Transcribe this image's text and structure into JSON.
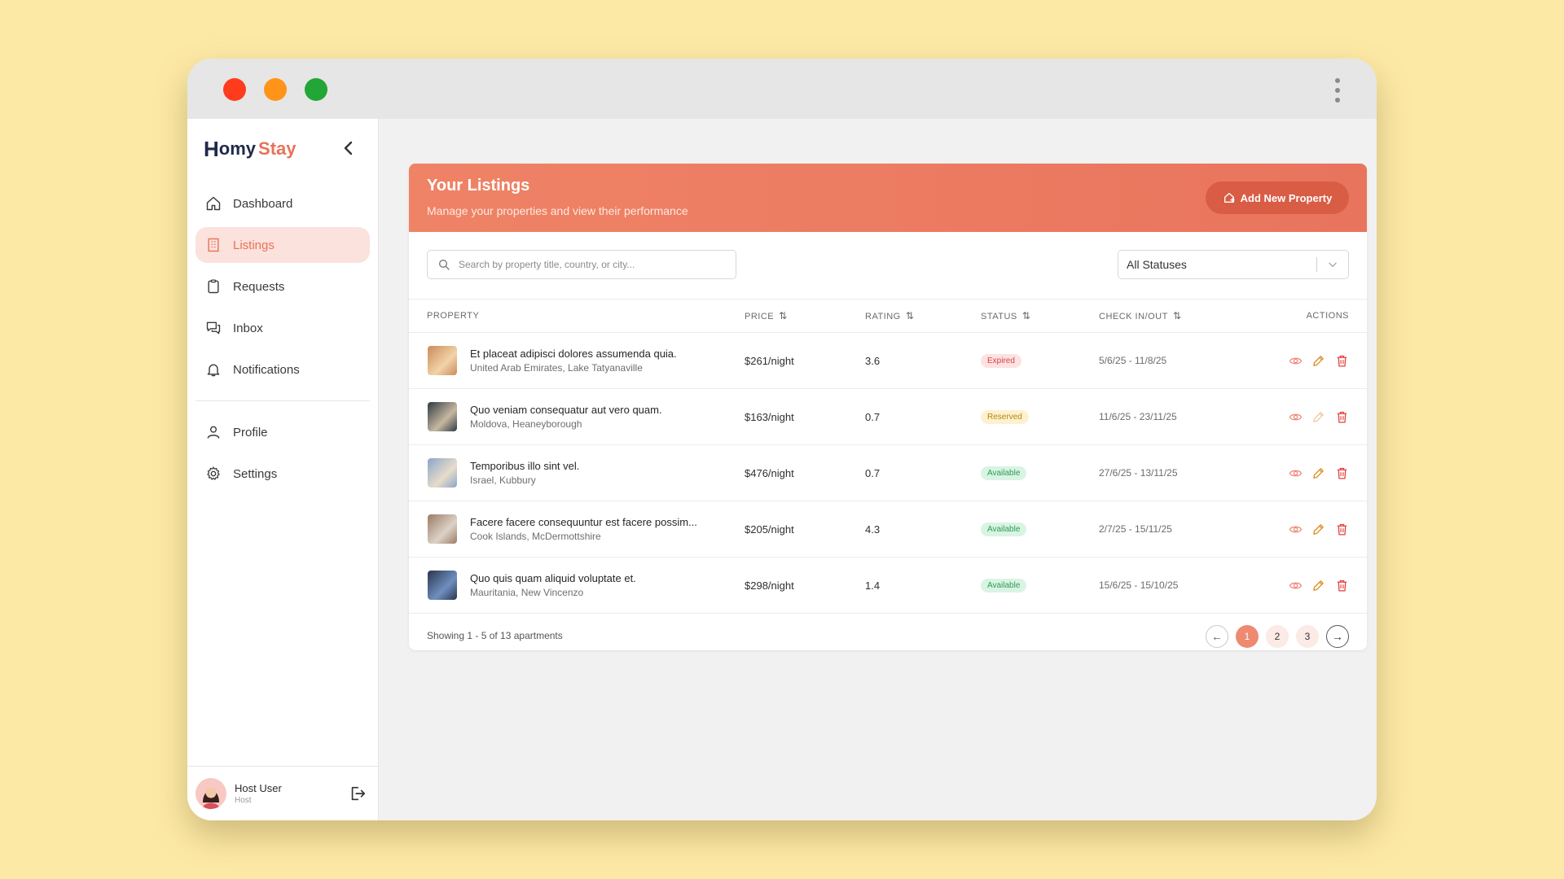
{
  "app": {
    "logo_homy": "omy",
    "logo_h": "H",
    "logo_stay": "Stay"
  },
  "sidebar": {
    "items": [
      {
        "label": "Dashboard",
        "icon": "home-icon",
        "active": false
      },
      {
        "label": "Listings",
        "icon": "building-icon",
        "active": true
      },
      {
        "label": "Requests",
        "icon": "clipboard-icon",
        "active": false
      },
      {
        "label": "Inbox",
        "icon": "chat-icon",
        "active": false
      },
      {
        "label": "Notifications",
        "icon": "bell-icon",
        "active": false
      }
    ],
    "secondary": [
      {
        "label": "Profile",
        "icon": "user-icon"
      },
      {
        "label": "Settings",
        "icon": "gear-icon"
      }
    ],
    "user": {
      "name": "Host User",
      "role": "Host"
    }
  },
  "header": {
    "title": "Your Listings",
    "subtitle": "Manage your properties and view their performance",
    "add_label": "Add New Property"
  },
  "filters": {
    "search_placeholder": "Search by property title, country, or city...",
    "status_value": "All Statuses"
  },
  "table": {
    "columns": [
      "PROPERTY",
      "PRICE",
      "RATING",
      "STATUS",
      "CHECK IN/OUT",
      "ACTIONS"
    ],
    "rows": [
      {
        "title": "Et placeat adipisci dolores assumenda quia.",
        "location": "United Arab Emirates, Lake Tatyanaville",
        "price": "$261/night",
        "rating": "3.6",
        "status": "Expired",
        "status_kind": "expired",
        "dates": "5/6/25 - 11/8/25",
        "edit_disabled": false
      },
      {
        "title": "Quo veniam consequatur aut vero quam.",
        "location": "Moldova, Heaneyborough",
        "price": "$163/night",
        "rating": "0.7",
        "status": "Reserved",
        "status_kind": "reserved",
        "dates": "11/6/25 - 23/11/25",
        "edit_disabled": true
      },
      {
        "title": "Temporibus illo sint vel.",
        "location": "Israel, Kubbury",
        "price": "$476/night",
        "rating": "0.7",
        "status": "Available",
        "status_kind": "available",
        "dates": "27/6/25 - 13/11/25",
        "edit_disabled": false
      },
      {
        "title": "Facere facere consequuntur est facere possim...",
        "location": "Cook Islands, McDermottshire",
        "price": "$205/night",
        "rating": "4.3",
        "status": "Available",
        "status_kind": "available",
        "dates": "2/7/25 - 15/11/25",
        "edit_disabled": false
      },
      {
        "title": "Quo quis quam aliquid voluptate et.",
        "location": "Mauritania, New Vincenzo",
        "price": "$298/night",
        "rating": "1.4",
        "status": "Available",
        "status_kind": "available",
        "dates": "15/6/25 - 15/10/25",
        "edit_disabled": false
      }
    ]
  },
  "footer": {
    "showing": "Showing 1 - 5 of 13 apartments",
    "pages": [
      "1",
      "2",
      "3"
    ],
    "current_page": "1",
    "prev_symbol": "←",
    "next_symbol": "→"
  },
  "colors": {
    "accent": "#e8725a",
    "background": "#fde9a6"
  }
}
